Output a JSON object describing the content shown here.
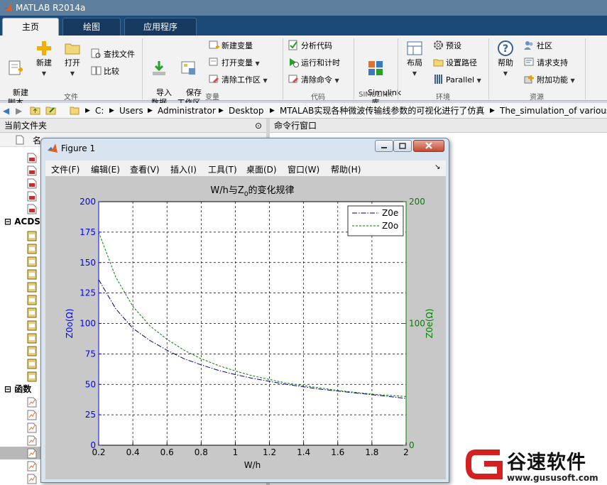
{
  "window": {
    "title": "MATLAB R2014a"
  },
  "tabs": [
    {
      "label": "主页"
    },
    {
      "label": "绘图"
    },
    {
      "label": "应用程序"
    }
  ],
  "ribbon": {
    "new_script": "新建\n脚本",
    "new": "新建",
    "open": "打开",
    "find_files": "查找文件",
    "compare": "比较",
    "file_group": "文件",
    "import_data": "导入\n数据",
    "save_workspace": "保存\n工作区",
    "new_variable": "新建变量",
    "open_variable": "打开变量",
    "clear_workspace": "清除工作区",
    "variable_group": "变量",
    "analyze_code": "分析代码",
    "run_and_time": "运行和计时",
    "clear_commands": "清除命令",
    "code_group": "代码",
    "simulink": "Simulink\n库",
    "simulink_group": "SIMULINK",
    "layout": "布局",
    "preferences": "预设",
    "set_path": "设置路径",
    "parallel": "Parallel",
    "environment_group": "环境",
    "help": "帮助",
    "community": "社区",
    "request_support": "请求支持",
    "addons": "附加功能",
    "resources_group": "资源"
  },
  "address": {
    "crumbs": [
      "C:",
      "Users",
      "Administrator",
      "Desktop",
      "MTALAB实现各种微波传输线参数的可视化进行了仿真",
      "The_simulation_of various_"
    ]
  },
  "panels": {
    "current_folder": "当前文件夹",
    "command_window": "命令行窗口",
    "name_col": "名",
    "section_acdsee": "ACDSe",
    "section_functions": "函数"
  },
  "figure": {
    "title": "Figure 1",
    "menu": [
      "文件(F)",
      "编辑(E)",
      "查看(V)",
      "插入(I)",
      "工具(T)",
      "桌面(D)",
      "窗口(W)",
      "帮助(H)"
    ]
  },
  "chart_data": {
    "type": "line",
    "title_main": "W/h与Z",
    "title_sub": "0",
    "title_tail": "的变化规律",
    "xlabel": "W/h",
    "ylabel_left": "Z0o(Ω)",
    "ylabel_right": "Z0e(Ω)",
    "xlim": [
      0.2,
      2
    ],
    "ylim": [
      0,
      200
    ],
    "ylim_right": [
      0,
      200
    ],
    "xticks": [
      "0.2",
      "0.4",
      "0.6",
      "0.8",
      "1",
      "1.2",
      "1.4",
      "1.6",
      "1.8",
      "2"
    ],
    "yticks_left": [
      "0",
      "25",
      "50",
      "75",
      "100",
      "125",
      "150",
      "175",
      "200"
    ],
    "yticks_right": [
      "0",
      "100",
      "200"
    ],
    "grid": true,
    "legend_position": "top-right",
    "colors": {
      "left_axis": "#0000ff",
      "right_axis": "#008000",
      "z0e": "#000080",
      "z0o": "#008000"
    },
    "series": [
      {
        "name": "Z0e",
        "style": "dash-dot",
        "x": [
          0.2,
          0.3,
          0.4,
          0.5,
          0.6,
          0.7,
          0.8,
          0.9,
          1.0,
          1.1,
          1.2,
          1.3,
          1.4,
          1.5,
          1.6,
          1.7,
          1.8,
          1.9,
          2.0
        ],
        "y": [
          136,
          112,
          96,
          86,
          78,
          71,
          66,
          61.5,
          58,
          55,
          52.5,
          50,
          48,
          46,
          44.5,
          43,
          41.5,
          40,
          38.5
        ]
      },
      {
        "name": "Z0o",
        "style": "dashed",
        "x": [
          0.2,
          0.3,
          0.4,
          0.5,
          0.6,
          0.7,
          0.8,
          0.9,
          1.0,
          1.1,
          1.2,
          1.3,
          1.4,
          1.5,
          1.6,
          1.7,
          1.8,
          1.9,
          2.0
        ],
        "y": [
          175,
          138,
          114,
          98,
          87,
          78,
          71,
          65.5,
          61,
          57,
          54,
          51,
          49,
          47,
          45,
          43.5,
          42,
          41,
          40
        ]
      }
    ]
  },
  "brand": {
    "name": "谷速软件",
    "url": "www.gususoft.com"
  }
}
